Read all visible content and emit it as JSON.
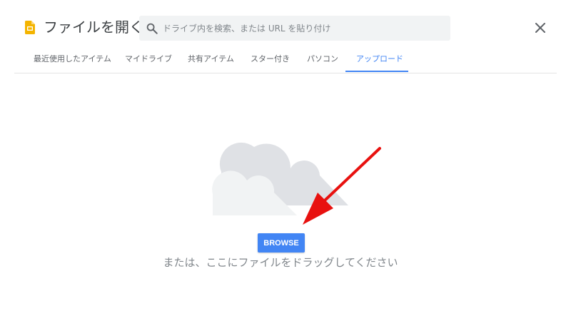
{
  "header": {
    "title": "ファイルを開く",
    "app_icon": "google-slides-icon",
    "close_icon": "close-icon"
  },
  "search": {
    "placeholder": "ドライブ内を検索、または URL を貼り付け",
    "value": "",
    "icon": "search-icon"
  },
  "tabs": [
    {
      "label": "最近使用したアイテム",
      "active": false
    },
    {
      "label": "マイドライブ",
      "active": false
    },
    {
      "label": "共有アイテム",
      "active": false
    },
    {
      "label": "スター付き",
      "active": false
    },
    {
      "label": "パソコン",
      "active": false
    },
    {
      "label": "アップロード",
      "active": true
    }
  ],
  "upload": {
    "illustration": "cloud-illustration",
    "browse_label": "BROWSE",
    "drop_hint": "または、ここにファイルをドラッグしてください"
  },
  "annotation": {
    "arrow_color": "#e8110f"
  },
  "colors": {
    "accent": "#4285f4",
    "app_icon": "#f4b400",
    "cloud_back": "#dfe1e5",
    "cloud_front": "#f1f3f4"
  }
}
